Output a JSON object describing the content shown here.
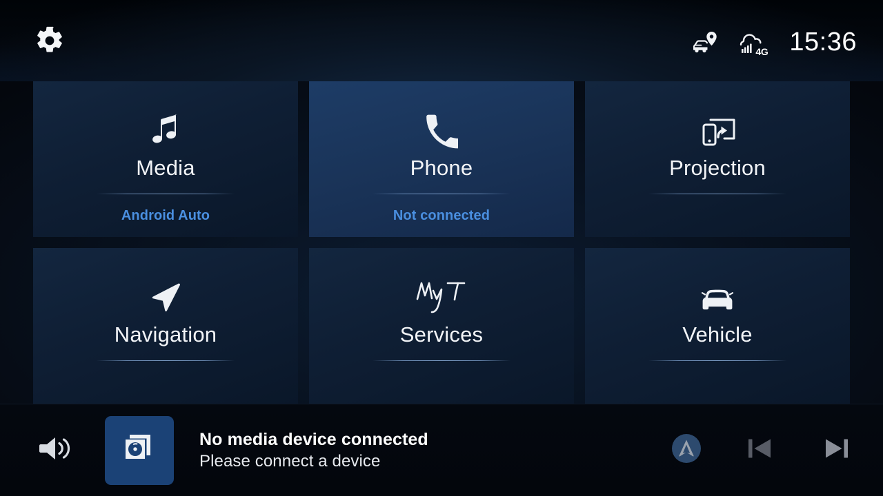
{
  "statusbar": {
    "settings_icon": "gear-icon",
    "vehicle_location_icon": "car-location-pin-icon",
    "network_icon": "cloud-signal-icon",
    "network_label": "4G",
    "clock": "15:36"
  },
  "tiles": [
    {
      "id": "media",
      "icon": "music-note-icon",
      "title": "Media",
      "subtitle": "Android Auto",
      "active": false
    },
    {
      "id": "phone",
      "icon": "phone-handset-icon",
      "title": "Phone",
      "subtitle": "Not connected",
      "active": true
    },
    {
      "id": "projection",
      "icon": "screen-cast-icon",
      "title": "Projection",
      "subtitle": "",
      "active": false
    },
    {
      "id": "navigation",
      "icon": "navigation-arrow-icon",
      "title": "Navigation",
      "subtitle": "",
      "active": false
    },
    {
      "id": "services",
      "icon": "myt-logo-icon",
      "title": "Services",
      "subtitle": "",
      "active": false
    },
    {
      "id": "vehicle",
      "icon": "car-front-icon",
      "title": "Vehicle",
      "subtitle": "",
      "active": false
    }
  ],
  "bottombar": {
    "volume_icon": "speaker-volume-icon",
    "album_art_icon": "cd-disc-case-icon",
    "track_title": "No media device connected",
    "track_subtitle": "Please connect a device",
    "source_icon": "android-auto-logo-icon",
    "previous_icon": "previous-track-icon",
    "next_icon": "next-track-icon"
  },
  "colors": {
    "accent_blue": "#4a8fe0",
    "tile_bg": "#0f1f35",
    "tile_active_bg": "#1a3459",
    "album_art_bg": "#1b4276",
    "android_auto_circle": "#2d4a6e",
    "transport_prev": "#585c66",
    "transport_next": "#8a8e98",
    "text_primary": "#f2f4f7"
  }
}
